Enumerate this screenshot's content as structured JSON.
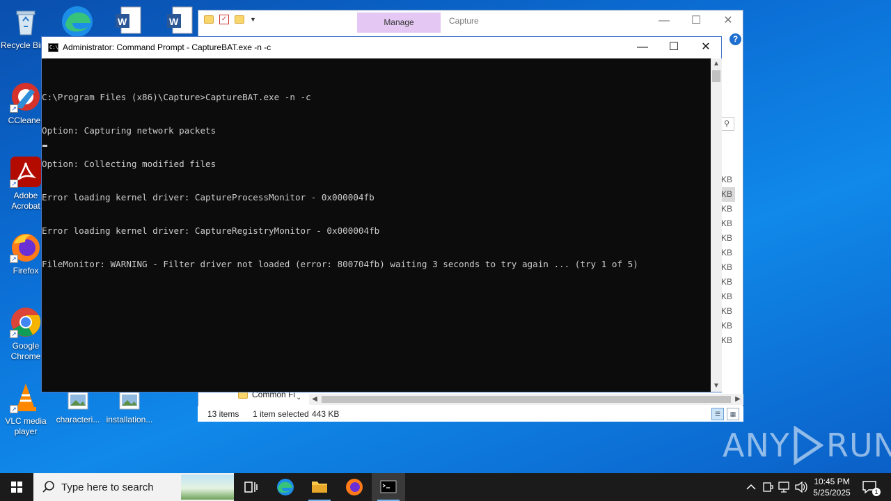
{
  "desktop": {
    "icons": [
      {
        "label": "Recycle Bin"
      },
      {
        "label": "CCleaner"
      },
      {
        "label": "Adobe Acrobat"
      },
      {
        "label": "Firefox"
      },
      {
        "label": "Google Chrome"
      },
      {
        "label": "VLC media player"
      },
      {
        "label": "characteri..."
      },
      {
        "label": "installation..."
      }
    ]
  },
  "explorer": {
    "ribbon_tab": "Manage",
    "title": "Capture",
    "size_column": [
      "KB",
      "KB",
      "KB",
      "KB",
      "KB",
      "KB",
      "KB",
      "KB",
      "KB",
      "KB",
      "KB",
      "KB"
    ],
    "tree_item": "Common Fi",
    "status": {
      "items": "13 items",
      "selected": "1 item selected",
      "size": "443 KB"
    }
  },
  "cmd": {
    "title": "Administrator: Command Prompt - CaptureBAT.exe  -n -c",
    "console_lines": [
      "C:\\Program Files (x86)\\Capture>CaptureBAT.exe -n -c",
      "Option: Capturing network packets",
      "Option: Collecting modified files",
      "Error loading kernel driver: CaptureProcessMonitor - 0x000004fb",
      "Error loading kernel driver: CaptureRegistryMonitor - 0x000004fb",
      "FileMonitor: WARNING - Filter driver not loaded (error: 800704fb) waiting 3 seconds to try again ... (try 1 of 5)"
    ]
  },
  "watermark": {
    "left": "ANY",
    "right": "RUN"
  },
  "taskbar": {
    "search_placeholder": "Type here to search",
    "clock_time": "10:45 PM",
    "clock_date": "5/25/2025",
    "notification_count": "1"
  },
  "colors": {
    "accent": "#0078d7",
    "taskbar": "#1b1b1b",
    "console_bg": "#0c0c0c",
    "console_fg": "#cccccc"
  }
}
